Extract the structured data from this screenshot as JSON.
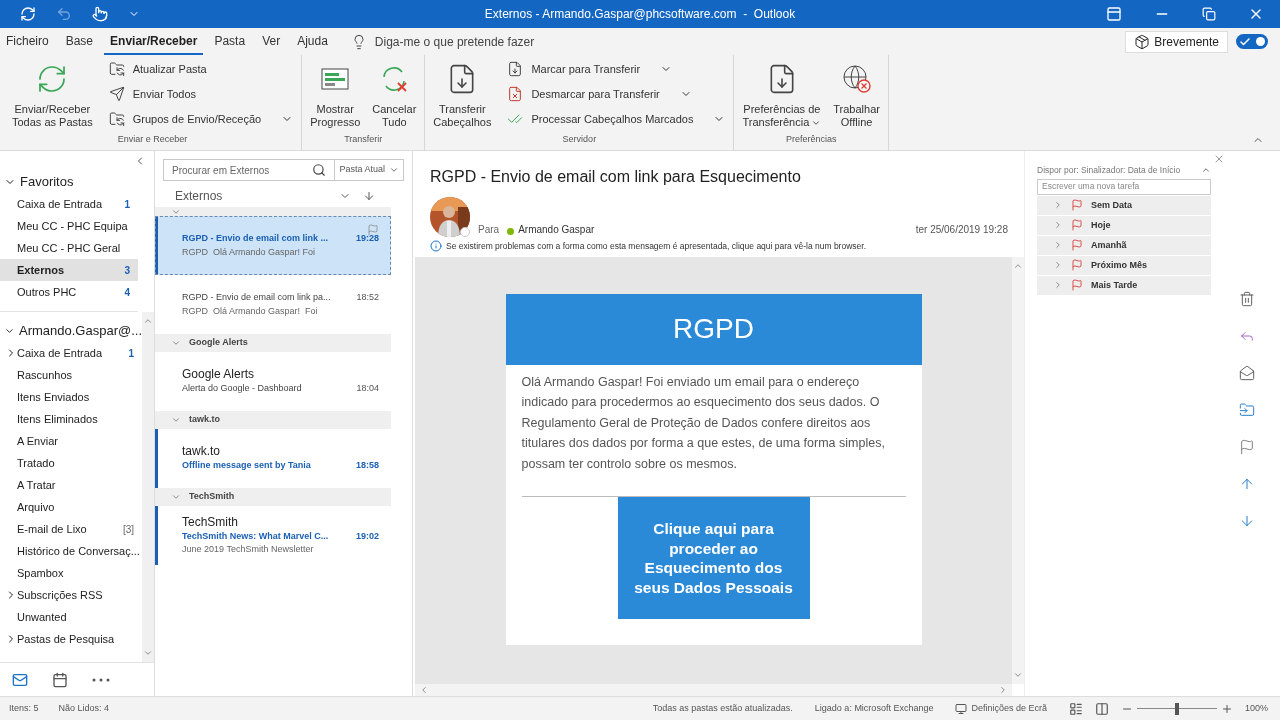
{
  "title_bar": {
    "title": "Externos - Armando.Gaspar@phcsoftware.com  -  Outlook"
  },
  "menu_tabs": [
    {
      "label": "Ficheiro",
      "selected": false
    },
    {
      "label": "Base",
      "selected": false
    },
    {
      "label": "Enviar/Receber",
      "selected": true
    },
    {
      "label": "Pasta",
      "selected": false
    },
    {
      "label": "Ver",
      "selected": false
    },
    {
      "label": "Ajuda",
      "selected": false
    }
  ],
  "tell_me": "Diga-me o que pretende fazer",
  "coming_soon": {
    "label": "Brevemente",
    "on": true
  },
  "ribbon_groups": [
    {
      "label": "Enviar e Receber",
      "buttons": [
        {
          "kind": "large",
          "lines": [
            "Enviar/Receber",
            "Todas as Pastas"
          ],
          "dropdown": false
        },
        {
          "kind": "small",
          "lines": [
            "Atualizar Pasta"
          ],
          "dropdown": false
        },
        {
          "kind": "small",
          "lines": [
            "Enviar Todos"
          ],
          "dropdown": false
        },
        {
          "kind": "small",
          "lines": [
            "Grupos de Envio/Receção"
          ],
          "dropdown": true
        }
      ]
    },
    {
      "label": "Transferir",
      "buttons": [
        {
          "kind": "large",
          "lines": [
            "Mostrar",
            "Progresso"
          ],
          "dropdown": false
        },
        {
          "kind": "large",
          "lines": [
            "Cancelar",
            "Tudo"
          ],
          "dropdown": false
        }
      ]
    },
    {
      "label": "Servidor",
      "buttons": [
        {
          "kind": "large",
          "lines": [
            "Transferir",
            "Cabeçalhos"
          ],
          "dropdown": false
        },
        {
          "kind": "small",
          "lines": [
            "Marcar para Transferir"
          ],
          "dropdown": true
        },
        {
          "kind": "small",
          "lines": [
            "Desmarcar para Transferir"
          ],
          "dropdown": true
        },
        {
          "kind": "small",
          "lines": [
            "Processar Cabeçalhos Marcados"
          ],
          "dropdown": true
        }
      ]
    },
    {
      "label": "Preferências",
      "buttons": [
        {
          "kind": "large",
          "lines": [
            "Preferências de",
            "Transferência"
          ],
          "dropdown": true
        },
        {
          "kind": "large",
          "lines": [
            "Trabalhar",
            "Offline"
          ],
          "dropdown": false
        }
      ]
    }
  ],
  "favorites": {
    "title": "Favoritos",
    "expanded": true,
    "items": [
      {
        "label": "Caixa de Entrada",
        "count": "1",
        "selected": false
      },
      {
        "label": "Meu CC - PHC Equipa",
        "selected": false
      },
      {
        "label": "Meu CC - PHC Geral",
        "selected": false
      },
      {
        "label": "Externos",
        "count": "3",
        "selected": true
      },
      {
        "label": "Outros PHC",
        "count": "4",
        "selected": false
      }
    ]
  },
  "account": {
    "title": "Armando.Gaspar@...",
    "expanded": true,
    "items": [
      {
        "label": "Caixa de Entrada",
        "count": "1",
        "expandable": true
      },
      {
        "label": "Rascunhos",
        "expandable": false
      },
      {
        "label": "Itens Enviados",
        "expandable": false
      },
      {
        "label": "Itens Eliminados",
        "expandable": false
      },
      {
        "label": "A Enviar",
        "expandable": false
      },
      {
        "label": "Tratado",
        "expandable": false
      },
      {
        "label": "A Tratar",
        "expandable": false
      },
      {
        "label": "Arquivo",
        "expandable": false
      },
      {
        "label": "E-mail de Lixo",
        "count": "[3]",
        "count_muted": true,
        "expandable": false
      },
      {
        "label": "Histórico de Conversaç...",
        "expandable": false
      },
      {
        "label": "Spambox",
        "expandable": false
      },
      {
        "label": "Subscrições RSS",
        "expandable": true
      },
      {
        "label": "Unwanted",
        "expandable": false
      },
      {
        "label": "Pastas de Pesquisa",
        "expandable": true
      }
    ]
  },
  "message_list": {
    "search_placeholder": "Procurar em Externos",
    "scope": "Pasta Atual",
    "folder": "Externos",
    "groups": [
      {
        "messages": [
          {
            "subject": "RGPD - Envio de email com link ...",
            "preview": "RGPD  Olá Armando Gaspar! Foi",
            "time": "19:28",
            "unread": true,
            "selected": true,
            "flag": true
          },
          {
            "subject": "RGPD - Envio de email com link pa...",
            "preview": "RGPD  Olá Armando Gaspar!  Foi",
            "time": "18:52",
            "unread": false,
            "selected": false,
            "flag": false
          }
        ]
      },
      {
        "label": "Google Alerts",
        "messages": [
          {
            "sender": "Google Alerts",
            "subject": "Alerta do Google - Dashboard",
            "time": "18:04",
            "unread": false,
            "selected": false,
            "flag": false
          }
        ]
      },
      {
        "label": "tawk.to",
        "messages": [
          {
            "sender": "tawk.to",
            "subject": "Offline message sent by Tania",
            "time": "18:58",
            "unread": true,
            "selected": false,
            "flag": false
          }
        ]
      },
      {
        "label": "TechSmith",
        "messages": [
          {
            "sender": "TechSmith",
            "subject": "TechSmith News: What Marvel C...",
            "preview": "June 2019 TechSmith Newsletter",
            "time": "19:02",
            "unread": true,
            "selected": false,
            "flag": false
          }
        ]
      }
    ]
  },
  "reading_pane": {
    "subject": "RGPD - Envio de email com link para Esquecimento",
    "to_label": "Para",
    "recipient": "Armando Gaspar",
    "date": "ter 25/06/2019 19:28",
    "info": "Se existirem problemas com a forma como esta mensagem é apresentada, clique aqui para vê-la num browser.",
    "email": {
      "header": "RGPD",
      "body": "Olá Armando Gaspar! Foi enviado um email para o endereço indicado para procedermos ao esquecimento dos seus dados. O Regulamento Geral de Proteção de Dados confere direitos aos titulares dos dados por forma a que estes, de uma forma simples, possam ter controlo sobre os mesmos.",
      "button": "Clique aqui para proceder ao Esquecimento dos seus Dados Pessoais"
    }
  },
  "tasks": {
    "arrange": "Dispor por: Sinalizador: Data de Início",
    "new_task_placeholder": "Escrever uma nova tarefa",
    "groups": [
      {
        "label": "Sem Data"
      },
      {
        "label": "Hoje"
      },
      {
        "label": "Amanhã"
      },
      {
        "label": "Próximo Mês"
      },
      {
        "label": "Mais Tarde"
      }
    ]
  },
  "status_bar": {
    "items": "Itens: 5",
    "unread": "Não Lidos: 4",
    "sync": "Todas as pastas estão atualizadas.",
    "connection": "Ligado a: Microsoft Exchange",
    "display_settings": "Definições de Ecrã",
    "zoom": {
      "level": 0.5,
      "reading": "100%"
    }
  }
}
